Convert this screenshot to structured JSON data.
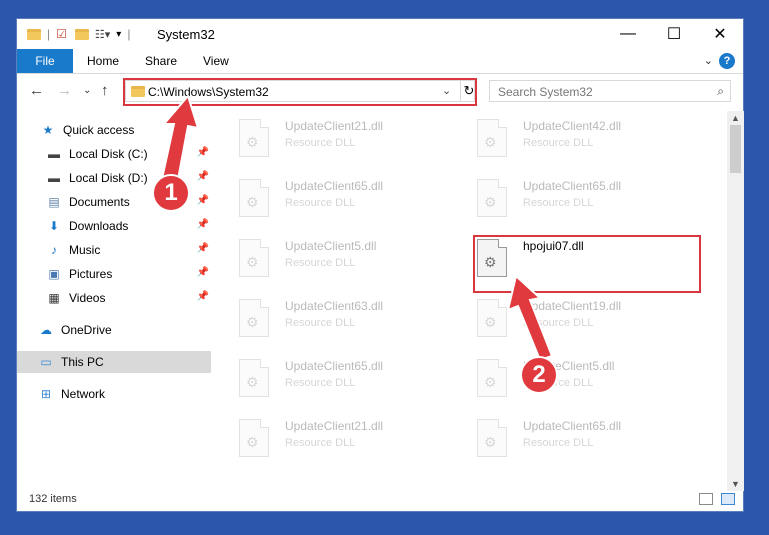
{
  "window": {
    "title": "System32"
  },
  "ribbon": {
    "tabs": [
      "File",
      "Home",
      "Share",
      "View"
    ]
  },
  "address": {
    "path": "C:\\Windows\\System32"
  },
  "search": {
    "placeholder": "Search System32"
  },
  "sidebar": {
    "items": [
      {
        "label": "Quick access"
      },
      {
        "label": "Local Disk (C:)"
      },
      {
        "label": "Local Disk (D:)"
      },
      {
        "label": "Documents"
      },
      {
        "label": "Downloads"
      },
      {
        "label": "Music"
      },
      {
        "label": "Pictures"
      },
      {
        "label": "Videos"
      },
      {
        "label": "OneDrive"
      },
      {
        "label": "This PC"
      },
      {
        "label": "Network"
      }
    ]
  },
  "files": {
    "col1": [
      {
        "name": "UpdateClient21.dll",
        "type": "Resource DLL"
      },
      {
        "name": "UpdateClient65.dll",
        "type": "Resource DLL"
      },
      {
        "name": "UpdateClient5.dll",
        "type": "Resource DLL"
      },
      {
        "name": "UpdateClient63.dll",
        "type": "Resource DLL"
      },
      {
        "name": "UpdateClient65.dll",
        "type": "Resource DLL"
      },
      {
        "name": "UpdateClient21.dll",
        "type": "Resource DLL"
      }
    ],
    "col2": [
      {
        "name": "UpdateClient42.dll",
        "type": "Resource DLL"
      },
      {
        "name": "UpdateClient65.dll",
        "type": "Resource DLL"
      },
      {
        "name": "hpojui07.dll",
        "type": ""
      },
      {
        "name": "UpdateClient19.dll",
        "type": "Resource DLL"
      },
      {
        "name": "UpdateClient5.dll",
        "type": "Resource DLL"
      },
      {
        "name": "UpdateClient65.dll",
        "type": "Resource DLL"
      }
    ]
  },
  "status": {
    "count": "132 items"
  },
  "callouts": {
    "one": "1",
    "two": "2"
  },
  "colors": {
    "accent": "#1979ca",
    "highlight": "#d9363e",
    "background": "#2b56a9"
  }
}
